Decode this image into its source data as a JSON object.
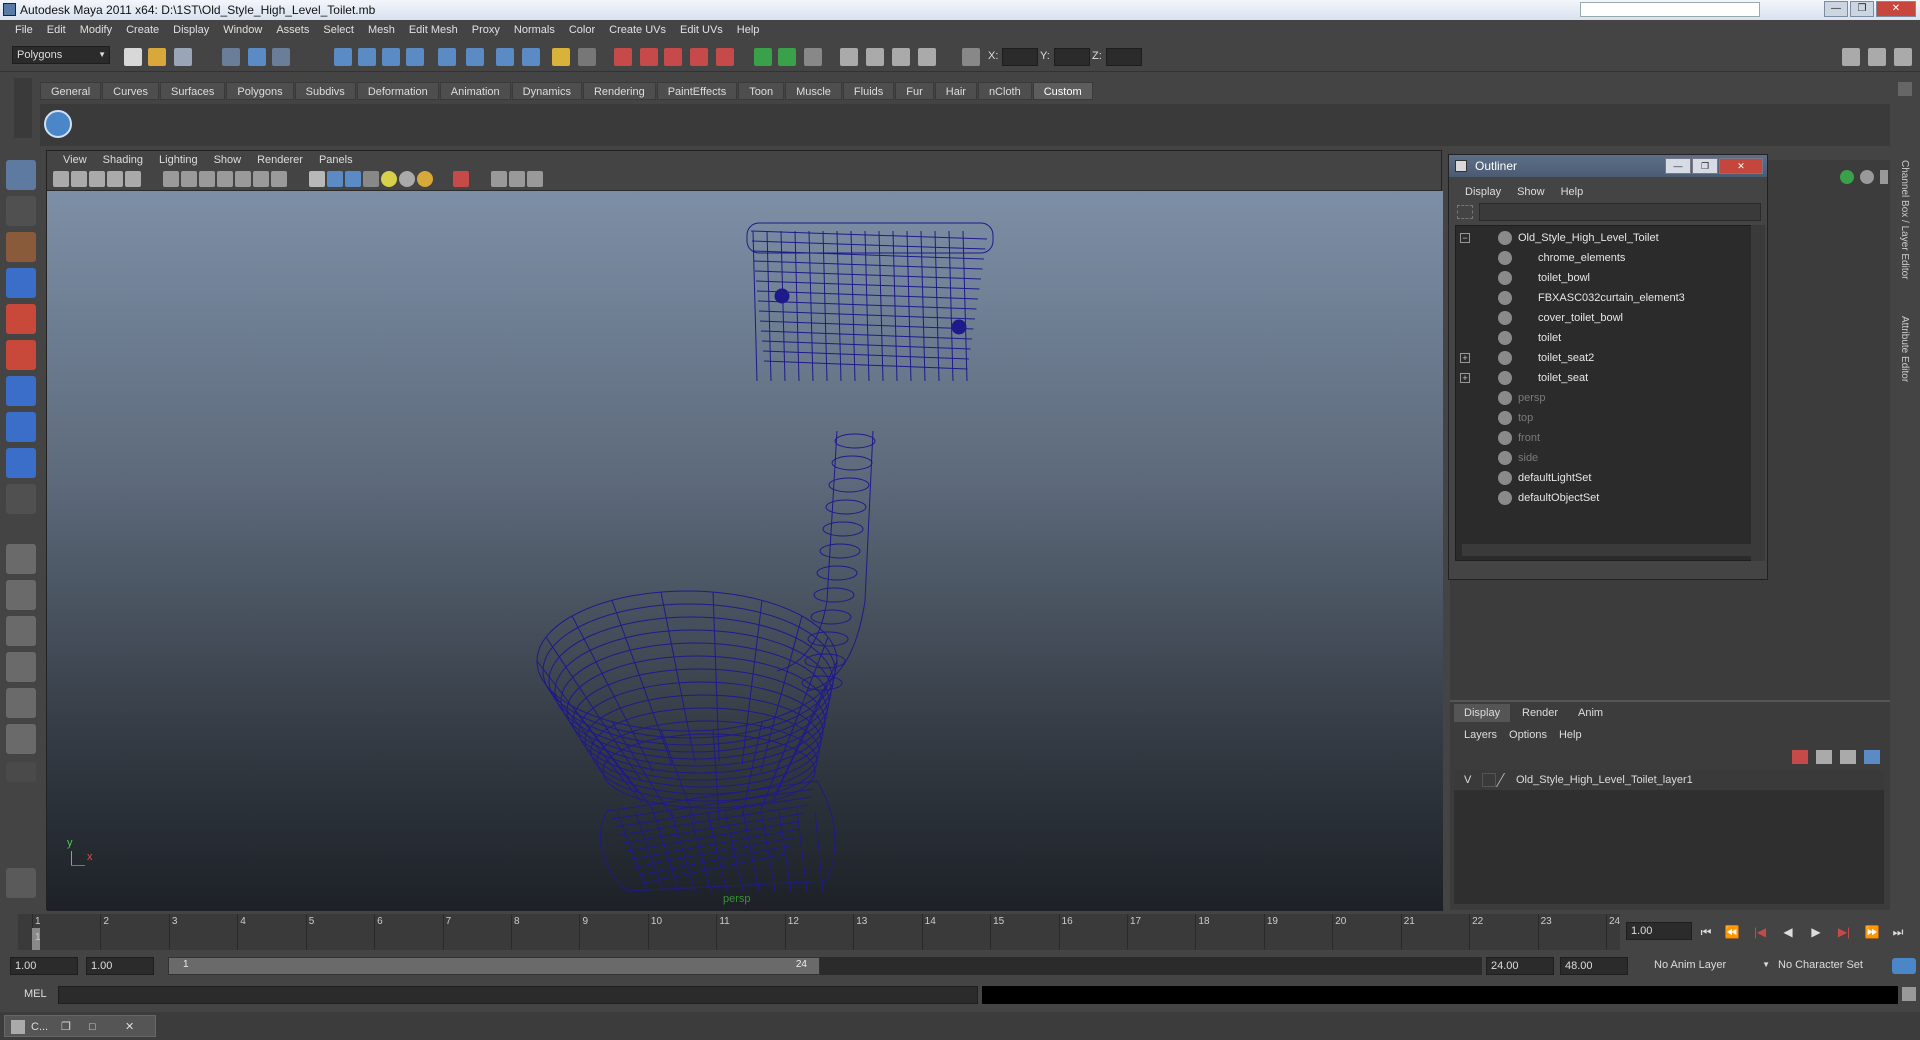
{
  "window": {
    "title": "Autodesk Maya 2011 x64: D:\\1ST\\Old_Style_High_Level_Toilet.mb",
    "controls": [
      "—",
      "❐",
      "✕"
    ]
  },
  "menubar": [
    "File",
    "Edit",
    "Modify",
    "Create",
    "Display",
    "Window",
    "Assets",
    "Select",
    "Mesh",
    "Edit Mesh",
    "Proxy",
    "Normals",
    "Color",
    "Create UVs",
    "Edit UVs",
    "Help"
  ],
  "statusline": {
    "menuset": "Polygons",
    "x_label": "X:",
    "y_label": "Y:",
    "z_label": "Z:"
  },
  "shelf": {
    "tabs": [
      "General",
      "Curves",
      "Surfaces",
      "Polygons",
      "Subdivs",
      "Deformation",
      "Animation",
      "Dynamics",
      "Rendering",
      "PaintEffects",
      "Toon",
      "Muscle",
      "Fluids",
      "Fur",
      "Hair",
      "nCloth",
      "Custom"
    ],
    "active_tab": "Custom"
  },
  "viewport": {
    "menu": [
      "View",
      "Shading",
      "Lighting",
      "Show",
      "Renderer",
      "Panels"
    ],
    "camera_label": "persp",
    "axis_y": "y",
    "axis_x": "x",
    "wire_color": "#1f1a8a"
  },
  "outliner": {
    "title": "Outliner",
    "menu": [
      "Display",
      "Show",
      "Help"
    ],
    "items": [
      {
        "label": "Old_Style_High_Level_Toilet",
        "indent": 0,
        "expand": "−",
        "dim": false
      },
      {
        "label": "chrome_elements",
        "indent": 1,
        "expand": "",
        "dim": false
      },
      {
        "label": "toilet_bowl",
        "indent": 1,
        "expand": "",
        "dim": false
      },
      {
        "label": "FBXASC032curtain_element3",
        "indent": 1,
        "expand": "",
        "dim": false
      },
      {
        "label": "cover_toilet_bowl",
        "indent": 1,
        "expand": "",
        "dim": false
      },
      {
        "label": "toilet",
        "indent": 1,
        "expand": "",
        "dim": false
      },
      {
        "label": "toilet_seat2",
        "indent": 1,
        "expand": "+",
        "dim": false
      },
      {
        "label": "toilet_seat",
        "indent": 1,
        "expand": "+",
        "dim": false
      },
      {
        "label": "persp",
        "indent": 0,
        "expand": "",
        "dim": true
      },
      {
        "label": "top",
        "indent": 0,
        "expand": "",
        "dim": true
      },
      {
        "label": "front",
        "indent": 0,
        "expand": "",
        "dim": true
      },
      {
        "label": "side",
        "indent": 0,
        "expand": "",
        "dim": true
      },
      {
        "label": "defaultLightSet",
        "indent": 0,
        "expand": "",
        "dim": false
      },
      {
        "label": "defaultObjectSet",
        "indent": 0,
        "expand": "",
        "dim": false
      }
    ]
  },
  "side_tabs": [
    "Channel Box / Layer Editor",
    "Attribute Editor"
  ],
  "layers": {
    "tabs": [
      "Display",
      "Render",
      "Anim"
    ],
    "active_tab": "Display",
    "menu": [
      "Layers",
      "Options",
      "Help"
    ],
    "row": {
      "visible": "V",
      "name": "Old_Style_High_Level_Toilet_layer1"
    }
  },
  "timeslider": {
    "frames": [
      "1",
      "2",
      "3",
      "4",
      "5",
      "6",
      "7",
      "8",
      "9",
      "10",
      "11",
      "12",
      "13",
      "14",
      "15",
      "16",
      "17",
      "18",
      "19",
      "20",
      "21",
      "22",
      "23",
      "24"
    ],
    "current_frame_marker": "1",
    "current_frame": "1.00"
  },
  "range": {
    "start": "1.00",
    "playback_start": "1.00",
    "range_start_label": "1",
    "range_end_label": "24",
    "playback_end": "24.00",
    "end": "48.00",
    "anim_layer": "No Anim Layer",
    "character_set": "No Character Set"
  },
  "cmdline": {
    "label": "MEL"
  },
  "taskbar": {
    "item_label": "C..."
  }
}
